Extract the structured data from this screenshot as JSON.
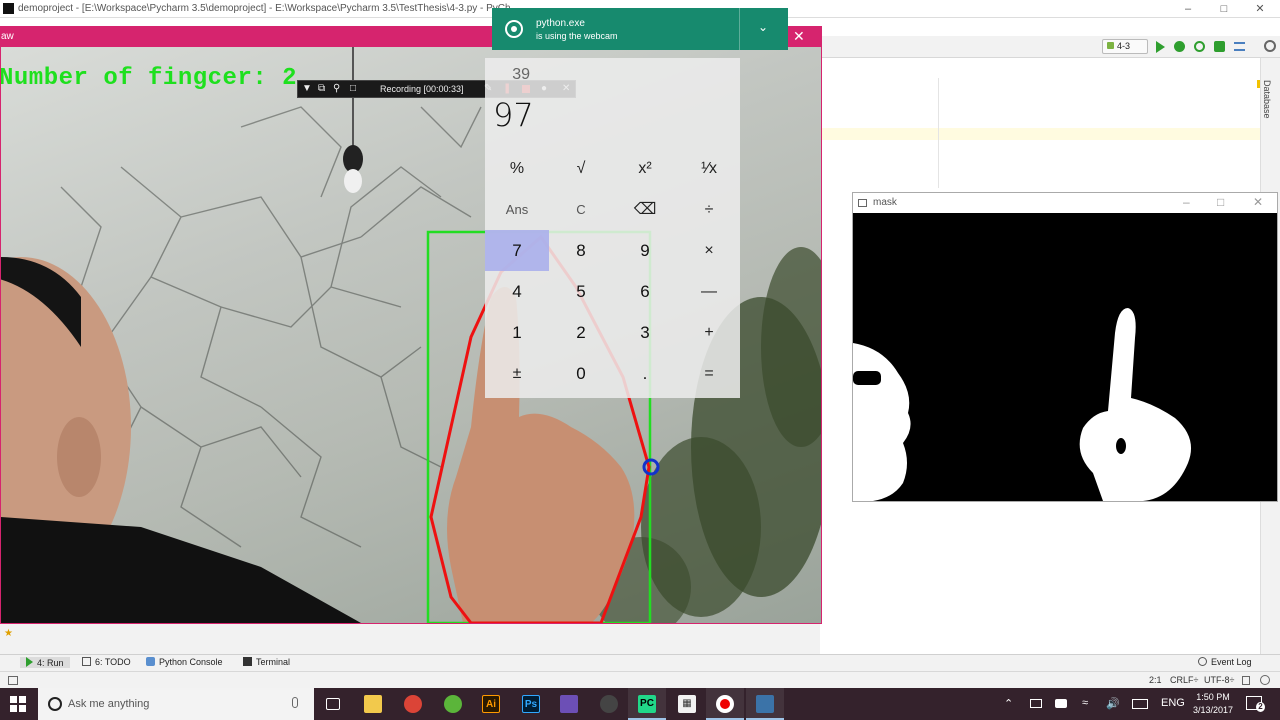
{
  "pycharm": {
    "title": "demoproject - [E:\\Workspace\\Pycharm 3.5\\demoproject] - E:\\Workspace\\Pycharm 3.5\\TestThesis\\4-3.py - PyCh",
    "run_config": "4-3",
    "right_panel_label": "Database",
    "bottom_tabs": {
      "run": "4: Run",
      "todo": "6: TODO",
      "python_console": "Python Console",
      "terminal": "Terminal",
      "event_log": "Event Log"
    },
    "status": {
      "position": "2:1",
      "line_ending": "CRLF÷",
      "encoding": "UTF-8÷"
    }
  },
  "camera_window": {
    "title": "aw",
    "overlay_text": "Number of fingcer: 2"
  },
  "recording": {
    "label": "Recording [00:00:33]"
  },
  "toast": {
    "app": "python.exe",
    "message": "is using the webcam"
  },
  "calculator": {
    "expression": "39",
    "display": "97",
    "keys": {
      "percent": "%",
      "sqrt": "√",
      "square": "x²",
      "reciprocal": "¹⁄x",
      "ans": "Ans",
      "clear": "C",
      "backspace": "⌫",
      "divide": "÷",
      "d7": "7",
      "d8": "8",
      "d9": "9",
      "multiply": "×",
      "d4": "4",
      "d5": "5",
      "d6": "6",
      "minus": "—",
      "d1": "1",
      "d2": "2",
      "d3": "3",
      "plus": "+",
      "negate": "±",
      "d0": "0",
      "decimal": ".",
      "equals": "="
    }
  },
  "mask_window": {
    "title": "mask"
  },
  "taskbar": {
    "search_placeholder": "Ask me anything",
    "language": "ENG",
    "time": "1:50 PM",
    "date": "3/13/2017",
    "notification_count": "2"
  },
  "colors": {
    "camera_title_bar": "#d6246e",
    "toast_background": "#178a6e",
    "overlay_text": "#1ee01e",
    "bounding_box": "#22dd22",
    "hull": "#ee1111",
    "taskbar": "#34222c",
    "calculator_selected_key": "#aaafeb"
  }
}
